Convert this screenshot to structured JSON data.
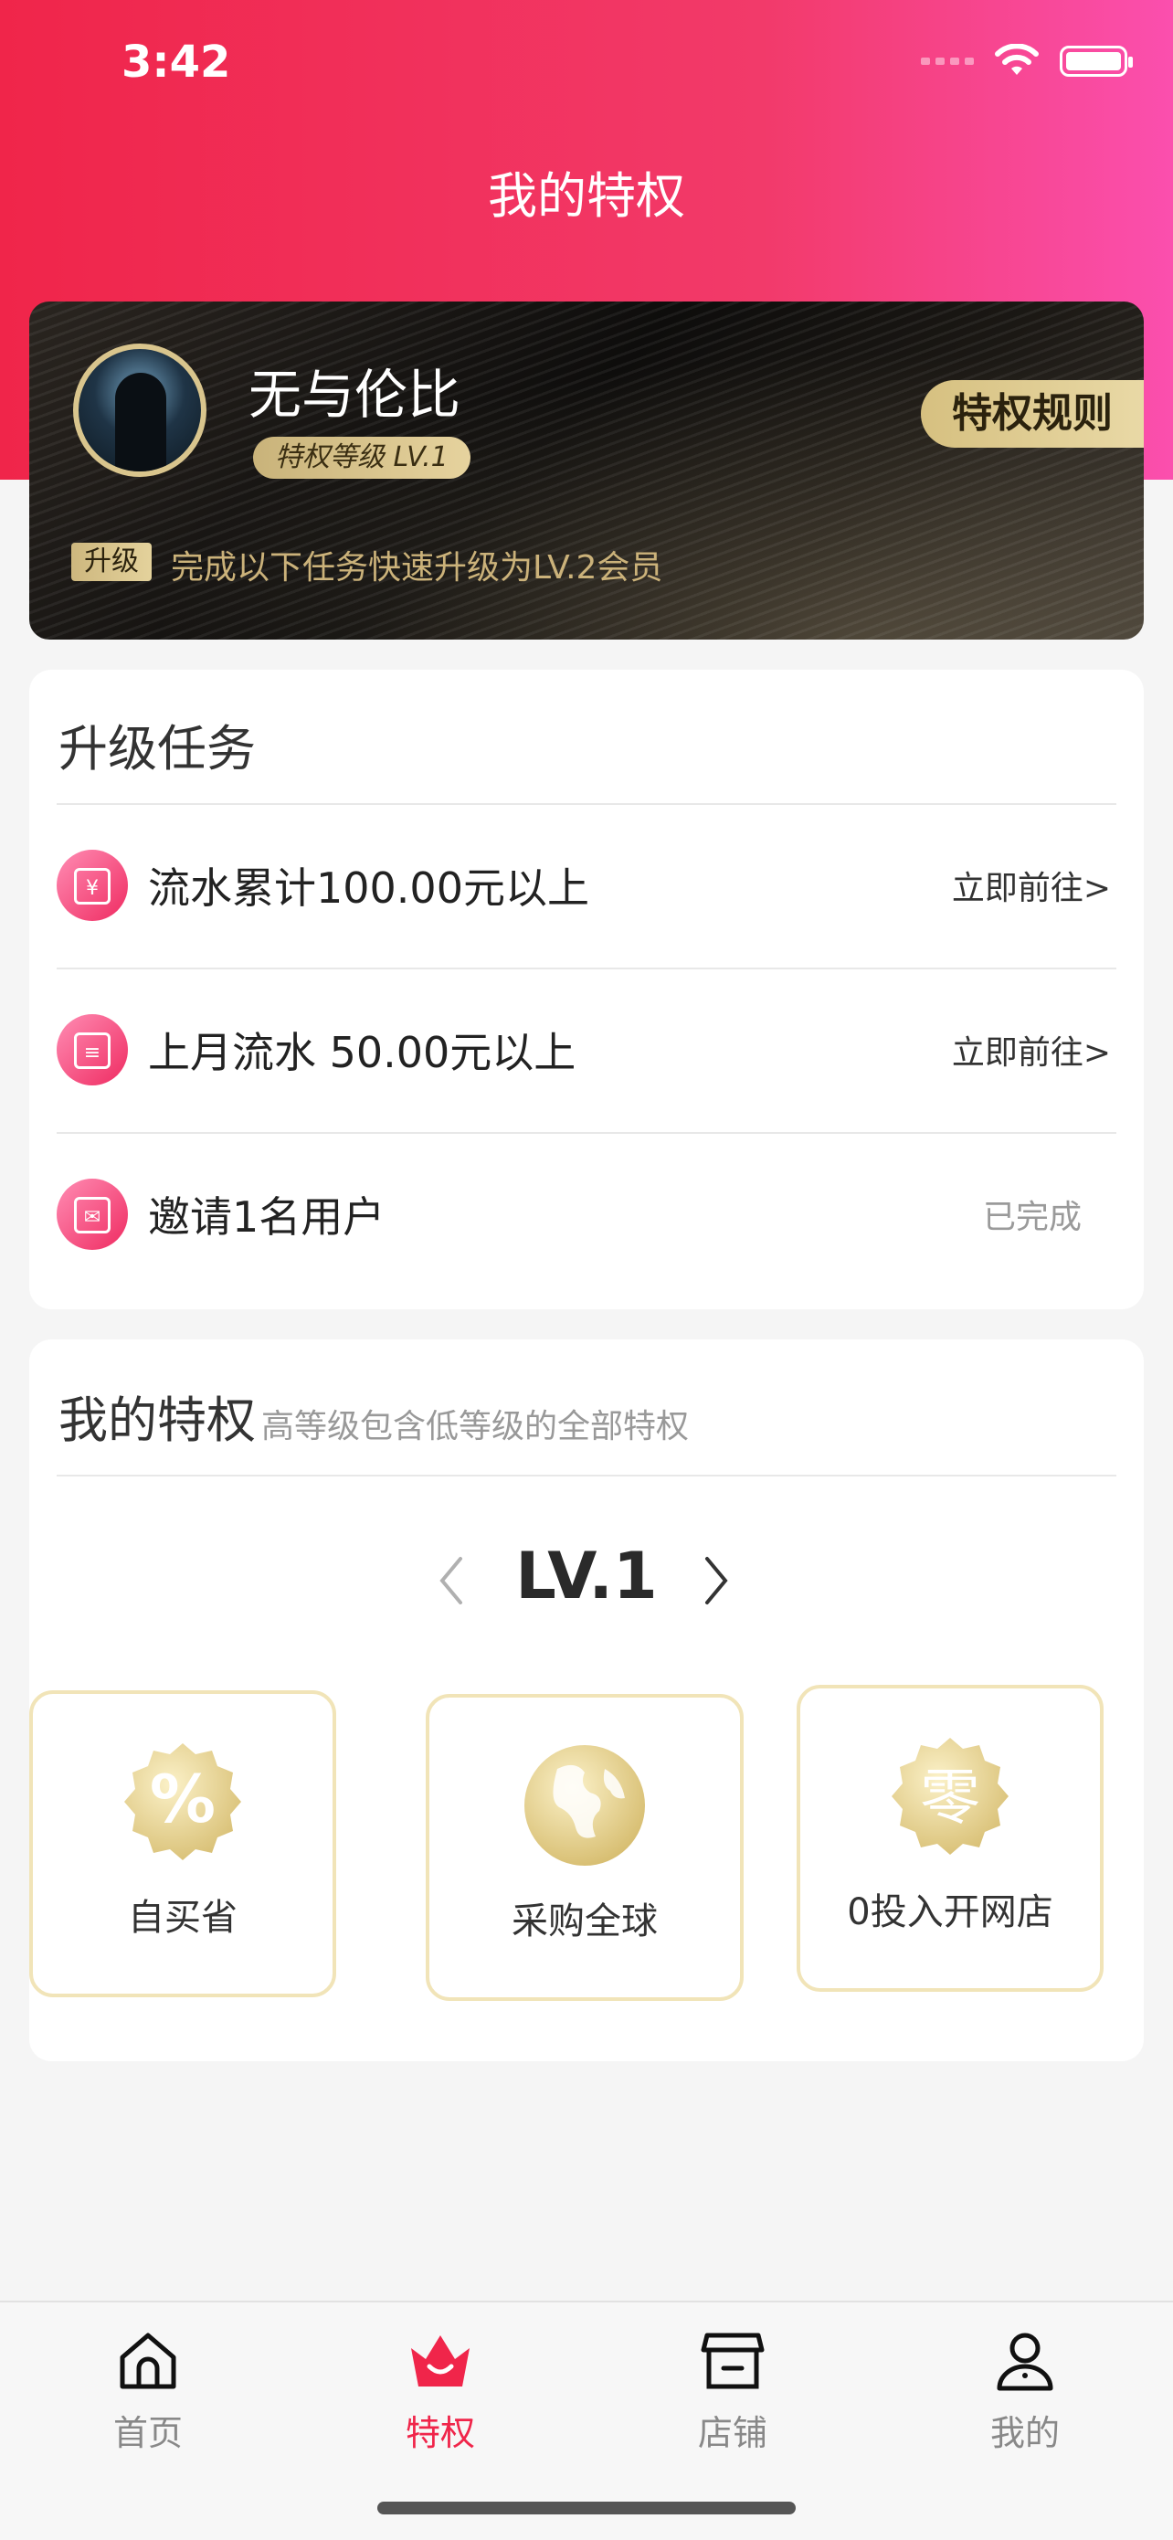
{
  "status_bar": {
    "time": "3:42"
  },
  "header": {
    "title": "我的特权"
  },
  "member_card": {
    "username": "无与伦比",
    "level_badge": "特权等级 LV.1",
    "rules_button": "特权规则",
    "upgrade_tag": "升级",
    "upgrade_text": "完成以下任务快速升级为LV.2会员"
  },
  "tasks": {
    "title": "升级任务",
    "items": [
      {
        "icon": "yuan-icon",
        "label": "流水累计100.00元以上",
        "action": "立即前往>"
      },
      {
        "icon": "receipt-icon",
        "label": "上月流水 50.00元以上",
        "action": "立即前往>"
      },
      {
        "icon": "invite-icon",
        "label": "邀请1名用户",
        "action": "已完成"
      }
    ]
  },
  "privileges": {
    "title": "我的特权",
    "subtitle": "高等级包含低等级的全部特权",
    "level": "LV.1",
    "items": [
      {
        "icon": "percent-badge-icon",
        "label": "自买省"
      },
      {
        "icon": "globe-icon",
        "label": "采购全球"
      },
      {
        "icon": "zero-badge-icon",
        "label": "0投入开网店",
        "icon_text": "零"
      }
    ]
  },
  "tabbar": {
    "items": [
      {
        "icon": "home-icon",
        "label": "首页"
      },
      {
        "icon": "crown-icon",
        "label": "特权",
        "active": true
      },
      {
        "icon": "store-icon",
        "label": "店铺"
      },
      {
        "icon": "user-icon",
        "label": "我的"
      }
    ]
  },
  "colors": {
    "accent": "#f0254a",
    "gold": "#d9c58d",
    "header_gradient_end": "#fb4fae"
  }
}
